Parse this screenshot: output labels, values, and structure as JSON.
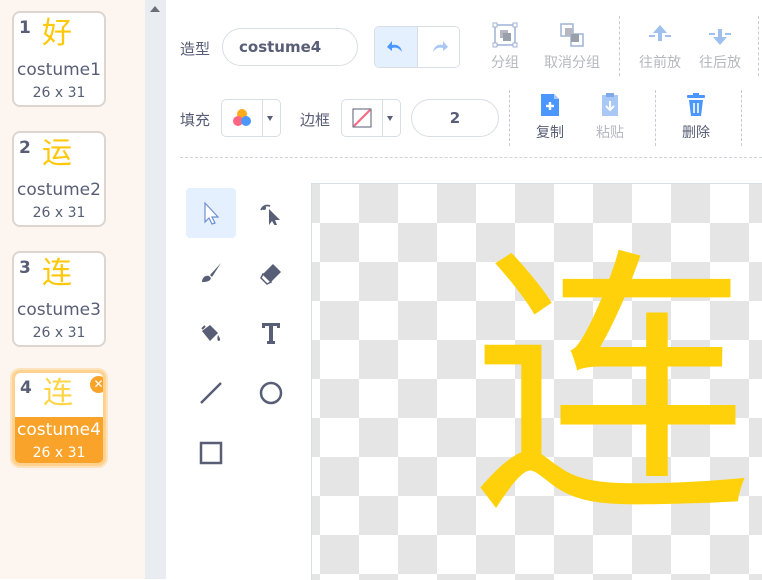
{
  "costumes": [
    {
      "number": "1",
      "glyph": "好",
      "name": "costume1",
      "size": "26 x 31"
    },
    {
      "number": "2",
      "glyph": "运",
      "name": "costume2",
      "size": "26 x 31"
    },
    {
      "number": "3",
      "glyph": "连",
      "name": "costume3",
      "size": "26 x 31"
    },
    {
      "number": "4",
      "glyph": "连",
      "name": "costume4",
      "size": "26 x 31",
      "selected": true
    }
  ],
  "editor": {
    "costume_label": "造型",
    "costume_name": "costume4",
    "group_label": "分组",
    "ungroup_label": "取消分组",
    "forward_label": "往前放",
    "backward_label": "往后放",
    "fill_label": "填充",
    "outline_label": "边框",
    "outline_width": "2",
    "copy_label": "复制",
    "paste_label": "粘贴",
    "delete_label": "删除"
  },
  "canvas": {
    "glyph": "连"
  },
  "colors": {
    "accent": "#4c97ff",
    "selected_card": "#f9a32a",
    "glyph": "#ffc80a",
    "text": "#575e75"
  },
  "icons": [
    "undo-icon",
    "redo-icon",
    "group-icon",
    "ungroup-icon",
    "forward-icon",
    "backward-icon",
    "copy-icon",
    "paste-icon",
    "delete-icon",
    "select-icon",
    "reshape-icon",
    "brush-icon",
    "eraser-icon",
    "fill-icon",
    "text-icon",
    "line-icon",
    "circle-icon",
    "rectangle-icon"
  ]
}
